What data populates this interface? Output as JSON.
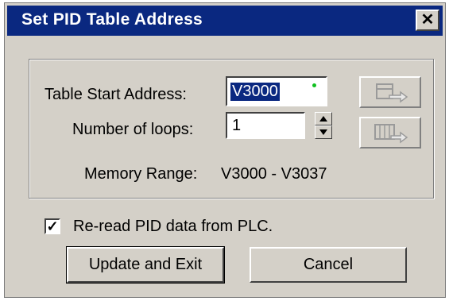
{
  "dialog": {
    "title": "Set PID Table Address",
    "close_glyph": "✕"
  },
  "table_start": {
    "label": "Table Start Address:",
    "value": "V3000"
  },
  "loops": {
    "label": "Number of loops:",
    "value": "1"
  },
  "memory_range": {
    "label": "Memory Range:",
    "value": "V3000 - V3037"
  },
  "reread": {
    "label": "Re-read PID data from PLC.",
    "checked": true,
    "check_glyph": "✓"
  },
  "buttons": {
    "update_exit": "Update and Exit",
    "cancel": "Cancel"
  },
  "icons": {
    "import": "table-import-icon",
    "export": "table-export-icon"
  },
  "colors": {
    "titlebar": "#0a2880",
    "dialog_bg": "#d4d0c8",
    "indicator_dot": "#10c020"
  }
}
